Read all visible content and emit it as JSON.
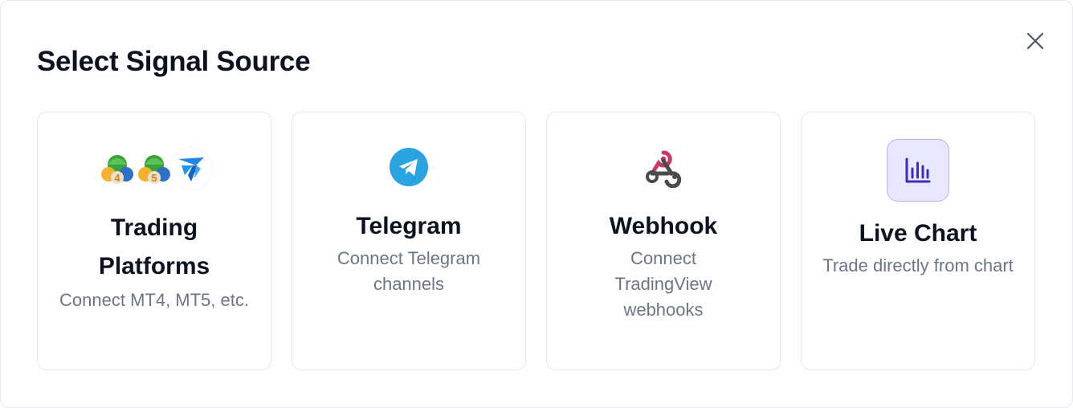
{
  "modal": {
    "title": "Select Signal Source",
    "close_icon": "close-icon"
  },
  "cards": [
    {
      "id": "trading-platforms",
      "title": "Trading Platforms",
      "description": "Connect MT4, MT5, etc.",
      "icons": [
        {
          "name": "mt4-icon",
          "badge": "4"
        },
        {
          "name": "mt5-icon",
          "badge": "5"
        },
        {
          "name": "tradelocker-icon"
        }
      ]
    },
    {
      "id": "telegram",
      "title": "Telegram",
      "description": "Connect Telegram channels",
      "icon": "telegram-icon",
      "icon_color": "#2aa3e0"
    },
    {
      "id": "webhook",
      "title": "Webhook",
      "description": "Connect TradingView webhooks",
      "icon": "webhook-icon",
      "icon_colors": [
        "#c73a63",
        "#4b4b4b"
      ]
    },
    {
      "id": "live-chart",
      "title": "Live Chart",
      "description": "Trade directly from chart",
      "icon": "bar-chart-icon",
      "icon_color": "#3b2fb8",
      "icon_bg": "#e9e7ff"
    }
  ]
}
